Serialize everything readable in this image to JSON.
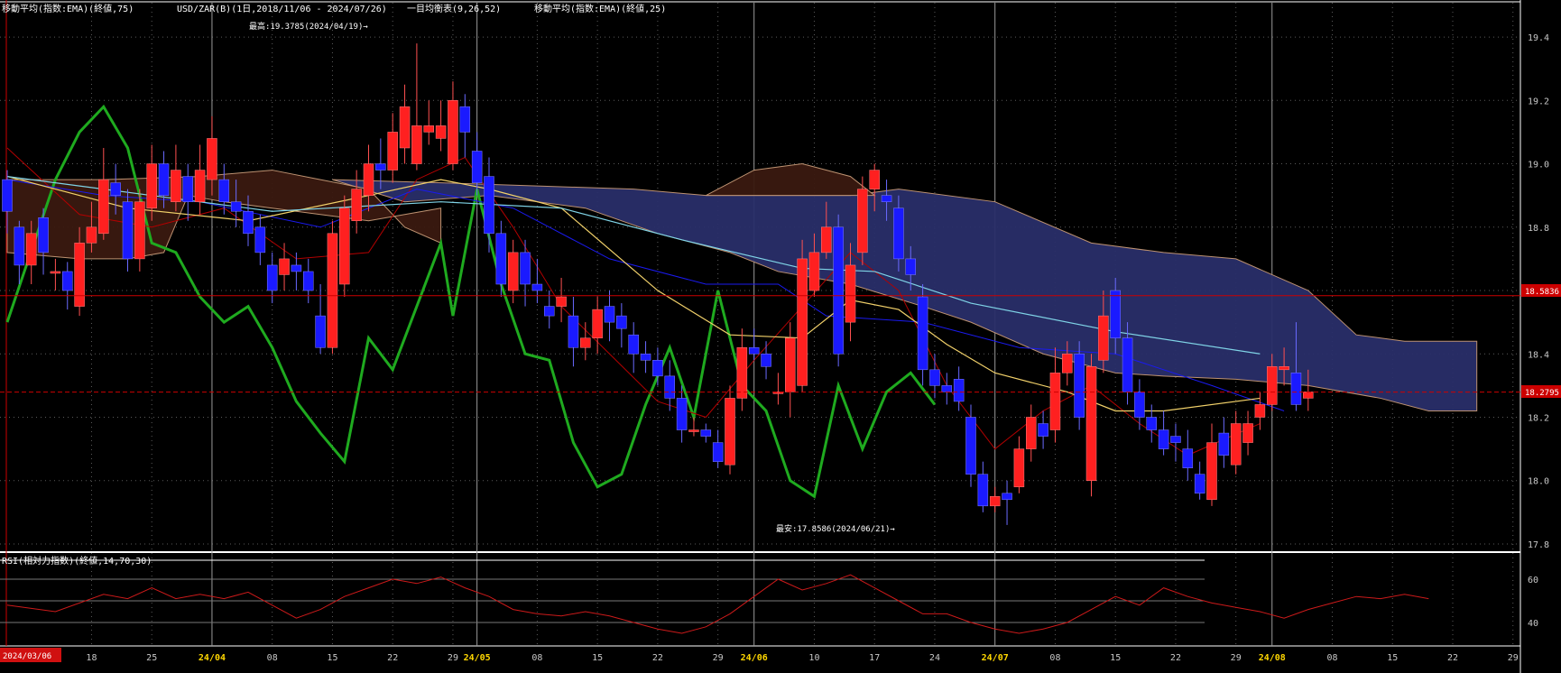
{
  "header": {
    "ema75_label": "移動平均(指数:EMA)(終値,75)",
    "symbol_label": "USD/ZAR(B)(1日,2018/11/06 - 2024/07/26)",
    "ichimoku_label": "一目均衡表(9,26,52)",
    "ema25_label": "移動平均(指数:EMA)(終値,25)"
  },
  "annotations": {
    "high": "最高:19.3785(2024/04/19)→",
    "low": "最安:17.8586(2024/06/21)→"
  },
  "price_tags": {
    "red_line": "18.5836",
    "current": "18.2795"
  },
  "rsi_panel": {
    "label": "RSI(相対力指数)(終値,14,70,30)"
  },
  "date_badge": "2024/03/06",
  "colors": {
    "background": "#000000",
    "bull": "#ff2020",
    "bear": "#1a1aff",
    "green_line": "#1faa1f",
    "ema25": "#f2d16a",
    "ema75": "#7fd3e6",
    "red_line": "#cc0000",
    "rsi": "#cc1a1a",
    "cloud_up": "#3a1a10",
    "cloud_down": "#2a2f6a"
  },
  "chart_data": [
    {
      "type": "candlestick",
      "title": "USD/ZAR(B)(1日,2018/11/06 - 2024/07/26)",
      "ylim": [
        17.78,
        19.46
      ],
      "y_ticks": [
        17.8,
        18.0,
        18.2,
        18.4,
        18.6,
        18.8,
        19.0,
        19.2,
        19.4
      ],
      "y_tick_labels": [
        "17.8",
        "18.0",
        "18.2",
        "18.4",
        "",
        "18.8",
        "19.0",
        "19.2",
        "19.4"
      ],
      "x_ticks": [
        {
          "label": "18",
          "i": 7,
          "month": false
        },
        {
          "label": "25",
          "i": 12,
          "month": false
        },
        {
          "label": "24/04",
          "i": 17,
          "month": true
        },
        {
          "label": "08",
          "i": 22,
          "month": false
        },
        {
          "label": "15",
          "i": 27,
          "month": false
        },
        {
          "label": "22",
          "i": 32,
          "month": false
        },
        {
          "label": "29",
          "i": 37,
          "month": false
        },
        {
          "label": "24/05",
          "i": 39,
          "month": true
        },
        {
          "label": "08",
          "i": 44,
          "month": false
        },
        {
          "label": "15",
          "i": 49,
          "month": false
        },
        {
          "label": "22",
          "i": 54,
          "month": false
        },
        {
          "label": "29",
          "i": 59,
          "month": false
        },
        {
          "label": "24/06",
          "i": 62,
          "month": true
        },
        {
          "label": "10",
          "i": 67,
          "month": false
        },
        {
          "label": "17",
          "i": 72,
          "month": false
        },
        {
          "label": "24",
          "i": 77,
          "month": false
        },
        {
          "label": "24/07",
          "i": 82,
          "month": true
        },
        {
          "label": "08",
          "i": 87,
          "month": false
        },
        {
          "label": "15",
          "i": 92,
          "month": false
        },
        {
          "label": "22",
          "i": 97,
          "month": false
        },
        {
          "label": "29",
          "i": 102,
          "month": false
        },
        {
          "label": "24/08",
          "i": 105,
          "month": true
        },
        {
          "label": "08",
          "i": 110,
          "month": false
        },
        {
          "label": "15",
          "i": 115,
          "month": false
        },
        {
          "label": "22",
          "i": 120,
          "month": false
        },
        {
          "label": "29",
          "i": 125,
          "month": false
        }
      ],
      "candles": [
        [
          18.95,
          18.85,
          18.98,
          18.78
        ],
        [
          18.8,
          18.68,
          18.82,
          18.62
        ],
        [
          18.68,
          18.78,
          18.82,
          18.62
        ],
        [
          18.83,
          18.72,
          18.86,
          18.65
        ],
        [
          18.66,
          18.66,
          18.7,
          18.6
        ],
        [
          18.66,
          18.6,
          18.69,
          18.54
        ],
        [
          18.55,
          18.75,
          18.8,
          18.52
        ],
        [
          18.75,
          18.8,
          18.88,
          18.72
        ],
        [
          18.78,
          18.95,
          19.05,
          18.76
        ],
        [
          18.94,
          18.9,
          19.0,
          18.84
        ],
        [
          18.88,
          18.7,
          18.92,
          18.66
        ],
        [
          18.7,
          18.88,
          18.92,
          18.66
        ],
        [
          18.86,
          19.0,
          19.06,
          18.82
        ],
        [
          19.0,
          18.9,
          19.04,
          18.86
        ],
        [
          18.88,
          18.98,
          19.06,
          18.85
        ],
        [
          18.96,
          18.88,
          19.0,
          18.82
        ],
        [
          18.88,
          18.98,
          19.06,
          18.84
        ],
        [
          18.95,
          19.08,
          19.15,
          18.9
        ],
        [
          18.95,
          18.88,
          19.0,
          18.84
        ],
        [
          18.88,
          18.85,
          18.95,
          18.8
        ],
        [
          18.85,
          18.78,
          18.9,
          18.74
        ],
        [
          18.8,
          18.72,
          18.84,
          18.68
        ],
        [
          18.68,
          18.6,
          18.72,
          18.56
        ],
        [
          18.65,
          18.7,
          18.75,
          18.6
        ],
        [
          18.68,
          18.66,
          18.72,
          18.6
        ],
        [
          18.66,
          18.6,
          18.7,
          18.56
        ],
        [
          18.52,
          18.42,
          18.62,
          18.4
        ],
        [
          18.42,
          18.78,
          18.82,
          18.4
        ],
        [
          18.62,
          18.86,
          18.9,
          18.58
        ],
        [
          18.82,
          18.92,
          18.98,
          18.78
        ],
        [
          18.9,
          19.0,
          19.06,
          18.85
        ],
        [
          19.0,
          18.98,
          19.08,
          18.92
        ],
        [
          18.98,
          19.1,
          19.16,
          18.94
        ],
        [
          19.05,
          19.18,
          19.25,
          19.0
        ],
        [
          19.0,
          19.12,
          19.38,
          18.98
        ],
        [
          19.1,
          19.12,
          19.2,
          19.06
        ],
        [
          19.08,
          19.12,
          19.2,
          19.04
        ],
        [
          19.0,
          19.2,
          19.26,
          18.98
        ],
        [
          19.18,
          19.1,
          19.22,
          19.02
        ],
        [
          19.04,
          18.94,
          19.1,
          18.9
        ],
        [
          18.96,
          18.78,
          19.02,
          18.72
        ],
        [
          18.78,
          18.62,
          18.82,
          18.58
        ],
        [
          18.6,
          18.72,
          18.76,
          18.56
        ],
        [
          18.72,
          18.62,
          18.76,
          18.55
        ],
        [
          18.62,
          18.6,
          18.7,
          18.56
        ],
        [
          18.55,
          18.52,
          18.6,
          18.48
        ],
        [
          18.55,
          18.58,
          18.64,
          18.5
        ],
        [
          18.52,
          18.42,
          18.58,
          18.36
        ],
        [
          18.42,
          18.45,
          18.5,
          18.38
        ],
        [
          18.45,
          18.54,
          18.58,
          18.4
        ],
        [
          18.55,
          18.5,
          18.6,
          18.44
        ],
        [
          18.52,
          18.48,
          18.56,
          18.42
        ],
        [
          18.46,
          18.4,
          18.5,
          18.34
        ],
        [
          18.4,
          18.38,
          18.44,
          18.34
        ],
        [
          18.38,
          18.33,
          18.42,
          18.3
        ],
        [
          18.33,
          18.26,
          18.38,
          18.22
        ],
        [
          18.26,
          18.16,
          18.3,
          18.12
        ],
        [
          18.16,
          18.16,
          18.2,
          18.14
        ],
        [
          18.16,
          18.14,
          18.18,
          18.12
        ],
        [
          18.12,
          18.06,
          18.16,
          18.04
        ],
        [
          18.05,
          18.26,
          18.3,
          18.02
        ],
        [
          18.26,
          18.42,
          18.48,
          18.22
        ],
        [
          18.42,
          18.4,
          18.48,
          18.38
        ],
        [
          18.4,
          18.36,
          18.44,
          18.32
        ],
        [
          18.28,
          18.28,
          18.34,
          18.24
        ],
        [
          18.28,
          18.45,
          18.5,
          18.2
        ],
        [
          18.3,
          18.7,
          18.76,
          18.28
        ],
        [
          18.6,
          18.72,
          18.78,
          18.58
        ],
        [
          18.72,
          18.8,
          18.88,
          18.7
        ],
        [
          18.8,
          18.4,
          18.84,
          18.36
        ],
        [
          18.5,
          18.68,
          18.75,
          18.44
        ],
        [
          18.72,
          18.92,
          18.96,
          18.68
        ],
        [
          18.92,
          18.98,
          19.0,
          18.85
        ],
        [
          18.9,
          18.88,
          18.95,
          18.82
        ],
        [
          18.86,
          18.7,
          18.9,
          18.66
        ],
        [
          18.7,
          18.65,
          18.74,
          18.6
        ],
        [
          18.58,
          18.35,
          18.62,
          18.3
        ],
        [
          18.35,
          18.3,
          18.4,
          18.26
        ],
        [
          18.3,
          18.28,
          18.34,
          18.24
        ],
        [
          18.32,
          18.25,
          18.36,
          18.22
        ],
        [
          18.2,
          18.02,
          18.24,
          17.98
        ],
        [
          18.02,
          17.92,
          18.06,
          17.9
        ],
        [
          17.92,
          17.95,
          17.98,
          17.9
        ],
        [
          17.96,
          17.94,
          18.0,
          17.86
        ],
        [
          17.98,
          18.1,
          18.14,
          17.96
        ],
        [
          18.1,
          18.2,
          18.24,
          18.06
        ],
        [
          18.18,
          18.14,
          18.22,
          18.1
        ],
        [
          18.16,
          18.34,
          18.42,
          18.12
        ],
        [
          18.34,
          18.4,
          18.44,
          18.3
        ],
        [
          18.4,
          18.2,
          18.44,
          18.16
        ],
        [
          18.0,
          18.36,
          18.4,
          17.95
        ],
        [
          18.38,
          18.52,
          18.6,
          18.34
        ],
        [
          18.6,
          18.45,
          18.64,
          18.4
        ],
        [
          18.45,
          18.28,
          18.5,
          18.24
        ],
        [
          18.28,
          18.2,
          18.32,
          18.16
        ],
        [
          18.2,
          18.16,
          18.24,
          18.12
        ],
        [
          18.16,
          18.1,
          18.22,
          18.08
        ],
        [
          18.14,
          18.12,
          18.18,
          18.06
        ],
        [
          18.1,
          18.04,
          18.16,
          18.0
        ],
        [
          18.02,
          17.96,
          18.06,
          17.94
        ],
        [
          17.94,
          18.12,
          18.18,
          17.92
        ],
        [
          18.15,
          18.08,
          18.2,
          18.04
        ],
        [
          18.05,
          18.18,
          18.22,
          18.02
        ],
        [
          18.12,
          18.18,
          18.22,
          18.08
        ],
        [
          18.2,
          18.24,
          18.28,
          18.16
        ],
        [
          18.24,
          18.36,
          18.4,
          18.22
        ],
        [
          18.35,
          18.36,
          18.42,
          18.3
        ],
        [
          18.34,
          18.24,
          18.5,
          18.22
        ],
        [
          18.26,
          18.28,
          18.35,
          18.22
        ]
      ],
      "series": [
        {
          "name": "移動平均(指数:EMA)(終値,25)",
          "color": "#f2d16a",
          "values": [
            [
              0,
              18.96
            ],
            [
              10,
              18.86
            ],
            [
              20,
              18.82
            ],
            [
              30,
              18.9
            ],
            [
              36,
              18.95
            ],
            [
              40,
              18.92
            ],
            [
              46,
              18.86
            ],
            [
              54,
              18.6
            ],
            [
              60,
              18.46
            ],
            [
              66,
              18.45
            ],
            [
              70,
              18.57
            ],
            [
              74,
              18.54
            ],
            [
              78,
              18.43
            ],
            [
              82,
              18.34
            ],
            [
              88,
              18.28
            ],
            [
              92,
              18.22
            ],
            [
              96,
              18.22
            ],
            [
              104,
              18.26
            ]
          ]
        },
        {
          "name": "移動平均(指数:EMA)(終値,75)",
          "color": "#7fd3e6",
          "values": [
            [
              0,
              18.96
            ],
            [
              12,
              18.9
            ],
            [
              22,
              18.85
            ],
            [
              36,
              18.88
            ],
            [
              46,
              18.86
            ],
            [
              56,
              18.76
            ],
            [
              66,
              18.67
            ],
            [
              72,
              18.66
            ],
            [
              80,
              18.56
            ],
            [
              92,
              18.47
            ],
            [
              104,
              18.4
            ]
          ]
        }
      ],
      "levels": [
        18.5836,
        18.2795
      ]
    },
    {
      "type": "line",
      "title": "RSI(相対力指数)(終値,14,70,30)",
      "ylim": [
        30,
        70
      ],
      "y_ticks": [
        40,
        50,
        60
      ],
      "y_tick_labels": [
        "40",
        "",
        "60"
      ],
      "series": [
        {
          "name": "RSI(相対力指数)(終値,14,70,30)",
          "color": "#cc1a1a",
          "values": [
            [
              0,
              48
            ],
            [
              4,
              45
            ],
            [
              8,
              53
            ],
            [
              10,
              51
            ],
            [
              12,
              56
            ],
            [
              14,
              51
            ],
            [
              16,
              53
            ],
            [
              18,
              51
            ],
            [
              20,
              54
            ],
            [
              22,
              48
            ],
            [
              24,
              42
            ],
            [
              26,
              46
            ],
            [
              28,
              52
            ],
            [
              30,
              56
            ],
            [
              32,
              60
            ],
            [
              34,
              58
            ],
            [
              36,
              61
            ],
            [
              38,
              56
            ],
            [
              40,
              52
            ],
            [
              42,
              46
            ],
            [
              44,
              44
            ],
            [
              46,
              43
            ],
            [
              48,
              45
            ],
            [
              50,
              43
            ],
            [
              52,
              40
            ],
            [
              54,
              37
            ],
            [
              56,
              35
            ],
            [
              58,
              38
            ],
            [
              60,
              44
            ],
            [
              62,
              52
            ],
            [
              64,
              60
            ],
            [
              66,
              55
            ],
            [
              68,
              58
            ],
            [
              70,
              62
            ],
            [
              72,
              56
            ],
            [
              74,
              50
            ],
            [
              76,
              44
            ],
            [
              78,
              44
            ],
            [
              80,
              40
            ],
            [
              82,
              37
            ],
            [
              84,
              35
            ],
            [
              86,
              37
            ],
            [
              88,
              40
            ],
            [
              90,
              46
            ],
            [
              92,
              52
            ],
            [
              94,
              48
            ],
            [
              96,
              56
            ],
            [
              98,
              52
            ],
            [
              100,
              49
            ],
            [
              102,
              47
            ],
            [
              104,
              45
            ],
            [
              106,
              42
            ],
            [
              108,
              46
            ],
            [
              110,
              49
            ],
            [
              112,
              52
            ],
            [
              114,
              51
            ],
            [
              116,
              53
            ],
            [
              118,
              51
            ]
          ]
        }
      ]
    }
  ]
}
